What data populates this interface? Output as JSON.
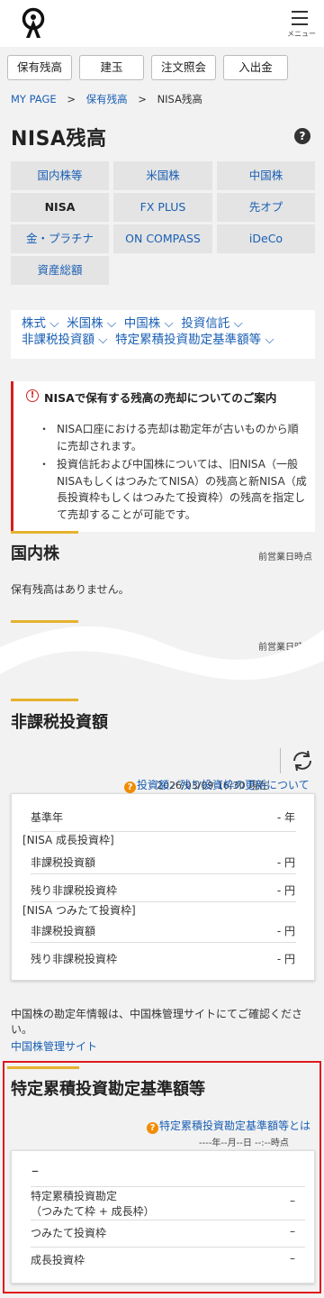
{
  "header": {
    "menu_label": "メニュー"
  },
  "top_buttons": [
    "保有残高",
    "建玉",
    "注文照会",
    "入出金"
  ],
  "breadcrumb": {
    "home": "MY PAGE",
    "sep": ">",
    "parent": "保有残高",
    "current": "NISA残高"
  },
  "page_title": "NISA残高",
  "help_glyph": "?",
  "grid": [
    {
      "label": "国内株等",
      "active": false
    },
    {
      "label": "米国株",
      "active": false
    },
    {
      "label": "中国株",
      "active": false
    },
    {
      "label": "NISA",
      "active": true
    },
    {
      "label": "FX PLUS",
      "active": false
    },
    {
      "label": "先オプ",
      "active": false
    },
    {
      "label": "金・プラチナ",
      "active": false
    },
    {
      "label": "ON COMPASS",
      "active": false
    },
    {
      "label": "iDeCo",
      "active": false
    },
    {
      "label": "資産総額",
      "active": false
    }
  ],
  "anchors": {
    "a1": "株式",
    "a2": "米国株",
    "a3": "中国株",
    "a4": "投資信託",
    "a5": "非課税投資額",
    "a6": "特定累積投資勘定基準額等"
  },
  "notice": {
    "icon": "!",
    "title": "NISAで保有する残高の売却についてのご案内",
    "items": [
      "NISA口座における売却は勘定年が古いものから順に売却されます。",
      "投資信託および中国株については、旧NISA（一般NISAもしくはつみたてNISA）の残高と新NISA（成長投資枠もしくはつみたて投資枠）の残高を指定して売却することが可能です。"
    ]
  },
  "domestic": {
    "title": "国内株",
    "as_of": "前営業日時点",
    "empty": "保有残高はありません。",
    "as_of_2": "前営業日時点"
  },
  "tax_free": {
    "title": "非課税投資額",
    "updated": "2026/03/09 16:30 現在",
    "help_link": "投資額／残り投資枠の更新について",
    "q": "?",
    "rows": {
      "base_year_label": "基準年",
      "base_year_value": "- 年",
      "growth_header": "[NISA 成長投資枠]",
      "g_invest_label": "非課税投資額",
      "g_invest_value": "- 円",
      "g_remain_label": "残り非課税投資枠",
      "g_remain_value": "- 円",
      "tsumi_header": "[NISA つみたて投資枠]",
      "t_invest_label": "非課税投資額",
      "t_invest_value": "- 円",
      "t_remain_label": "残り非課税投資枠",
      "t_remain_value": "- 円"
    },
    "china_note": "中国株の勘定年情報は、中国株管理サイトにてご確認ください。",
    "china_link": "中国株管理サイト"
  },
  "specified": {
    "title": "特定累積投資勘定基準額等",
    "help_link": "特定累積投資勘定基準額等とは",
    "q": "?",
    "as_of": "----年--月--日 --:--時点",
    "top_value": "–",
    "row1_label_a": "特定累積投資勘定",
    "row1_label_b": "（つみたて枠 + 成長枠）",
    "row1_value": "–",
    "row2_label": "つみたて投資枠",
    "row2_value": "–",
    "row3_label": "成長投資枠",
    "row3_value": "–"
  },
  "colors": {
    "accent_blue": "#1a5fb4",
    "alert_red": "#d42020",
    "section_gold": "#e6b22e",
    "help_orange": "#f28c00"
  }
}
